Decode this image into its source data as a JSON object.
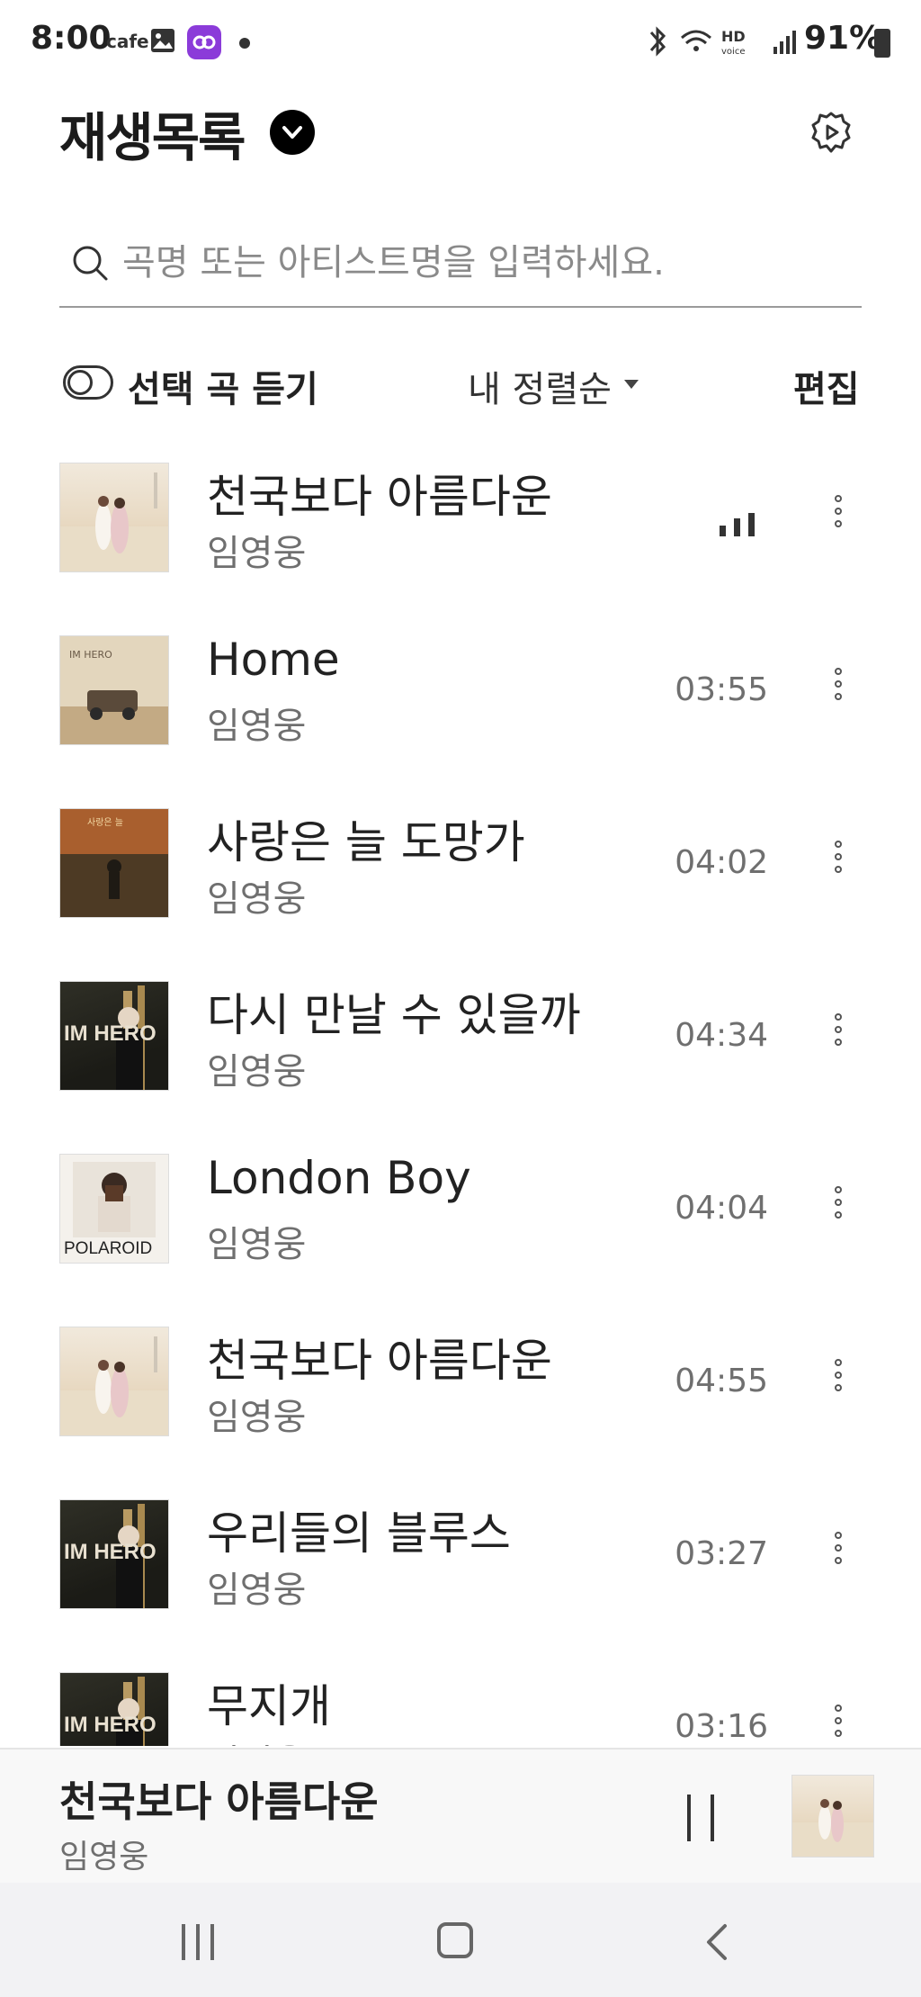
{
  "status_bar": {
    "time": "8:00",
    "cafe_label": "cafe",
    "battery": "91%",
    "icons": [
      "image-icon",
      "app-icon",
      "dot-icon",
      "bluetooth-icon",
      "wifi-icon",
      "hd-voice-icon",
      "signal-icon",
      "battery-icon"
    ]
  },
  "header": {
    "title": "재생목록",
    "settings_icon": "settings-play-icon"
  },
  "search": {
    "placeholder": "곡명 또는 아티스트명을 입력하세요."
  },
  "toolbar": {
    "toggle_label": "선택 곡 듣기",
    "sort_label": "내 정렬순",
    "edit_label": "편집"
  },
  "playlist": [
    {
      "title": "천국보다 아름다운",
      "artist": "임영웅",
      "duration": "",
      "playing": true
    },
    {
      "title": "Home",
      "artist": "임영웅",
      "duration": "03:55",
      "playing": false
    },
    {
      "title": "사랑은 늘 도망가",
      "artist": "임영웅",
      "duration": "04:02",
      "playing": false
    },
    {
      "title": "다시 만날 수 있을까",
      "artist": "임영웅",
      "duration": "04:34",
      "playing": false
    },
    {
      "title": "London Boy",
      "artist": "임영웅",
      "duration": "04:04",
      "playing": false
    },
    {
      "title": "천국보다 아름다운",
      "artist": "임영웅",
      "duration": "04:55",
      "playing": false
    },
    {
      "title": "우리들의 블루스",
      "artist": "임영웅",
      "duration": "03:27",
      "playing": false
    },
    {
      "title": "무지개",
      "artist": "임영웅",
      "duration": "03:16",
      "playing": false
    }
  ],
  "album_text": {
    "im_hero": "IM HERO",
    "polaroid": "POLAROID"
  },
  "mini_player": {
    "title": "천국보다 아름다운",
    "artist": "임영웅"
  },
  "colors": {
    "accent": "#000000",
    "text_primary": "#222222",
    "text_secondary": "#6f6f6f",
    "app_icon": "#8b3bd9"
  }
}
